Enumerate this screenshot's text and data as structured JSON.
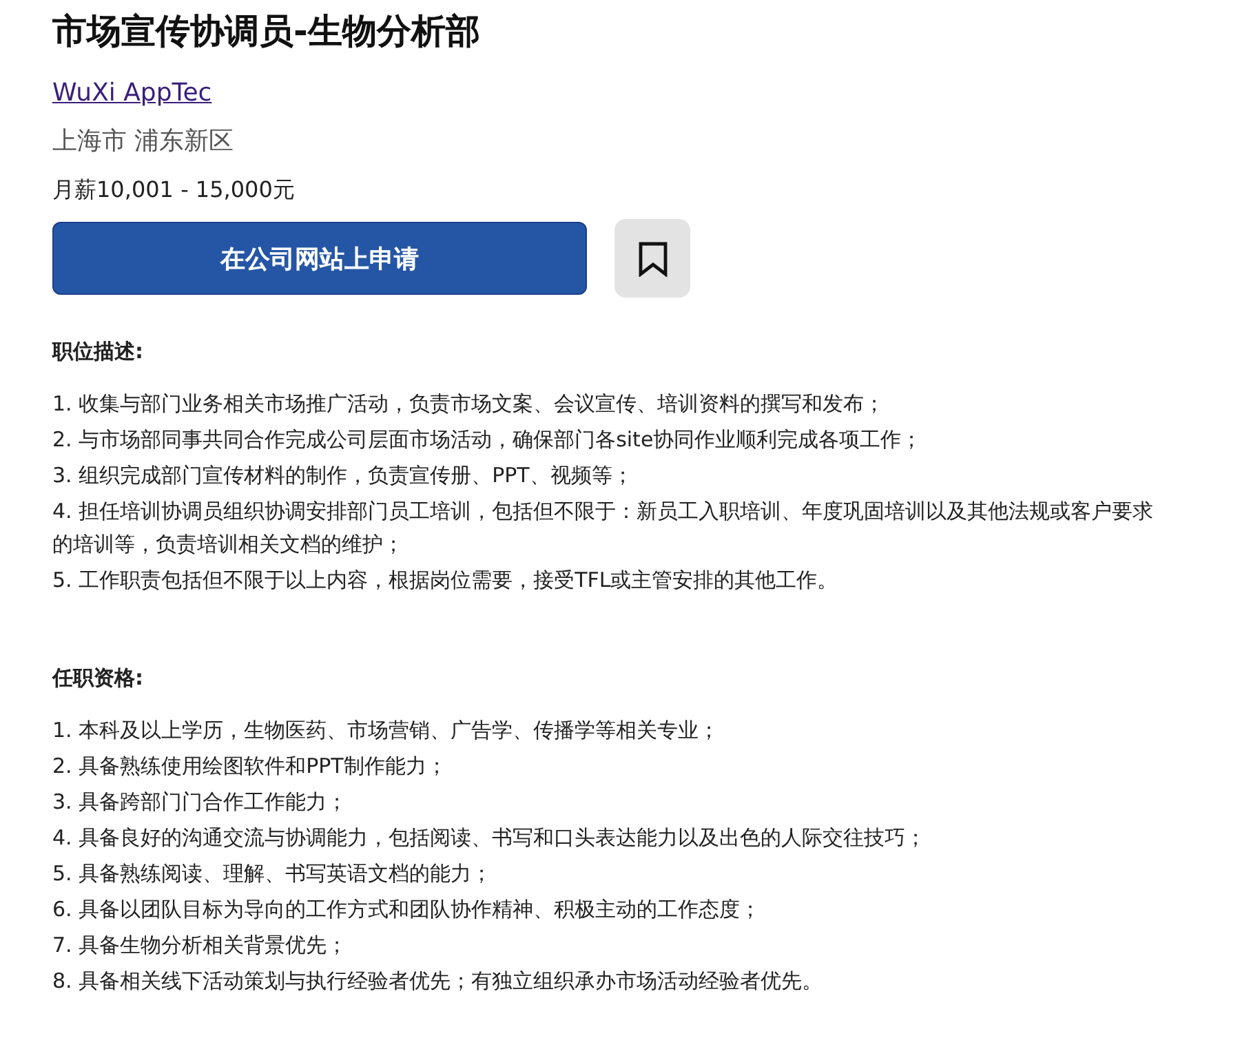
{
  "job_title": "市场宣传协调员-生物分析部",
  "company": "WuXi AppTec",
  "location": "上海市 浦东新区",
  "salary": "月薪10,001 - 15,000元",
  "apply_button": "在公司网站上申请",
  "saved": false,
  "sections": [
    {
      "heading": "职位描述:",
      "items": [
        "1. 收集与部门业务相关市场推广活动，负责市场文案、会议宣传、培训资料的撰写和发布；",
        "2. 与市场部同事共同合作完成公司层面市场活动，确保部门各site协同作业顺利完成各项工作；",
        "3. 组织完成部门宣传材料的制作，负责宣传册、PPT、视频等；",
        "4. 担任培训协调员组织协调安排部门员工培训，包括但不限于：新员工入职培训、年度巩固培训以及其他法规或客户要求的培训等，负责培训相关文档的维护；",
        "5. 工作职责包括但不限于以上内容，根据岗位需要，接受TFL或主管安排的其他工作。"
      ]
    },
    {
      "heading": "任职资格:",
      "items": [
        "1. 本科及以上学历，生物医药、市场营销、广告学、传播学等相关专业；",
        "2. 具备熟练使用绘图软件和PPT制作能力；",
        "3. 具备跨部门门合作工作能力；",
        "4. 具备良好的沟通交流与协调能力，包括阅读、书写和口头表达能力以及出色的人际交往技巧；",
        "5. 具备熟练阅读、理解、书写英语文档的能力；",
        "6. 具备以团队目标为导向的工作方式和团队协作精神、积极主动的工作态度；",
        "7. 具备生物分析相关背景优先；",
        "8. 具备相关线下活动策划与执行经验者优先；有独立组织承办市场活动经验者优先。"
      ]
    }
  ]
}
